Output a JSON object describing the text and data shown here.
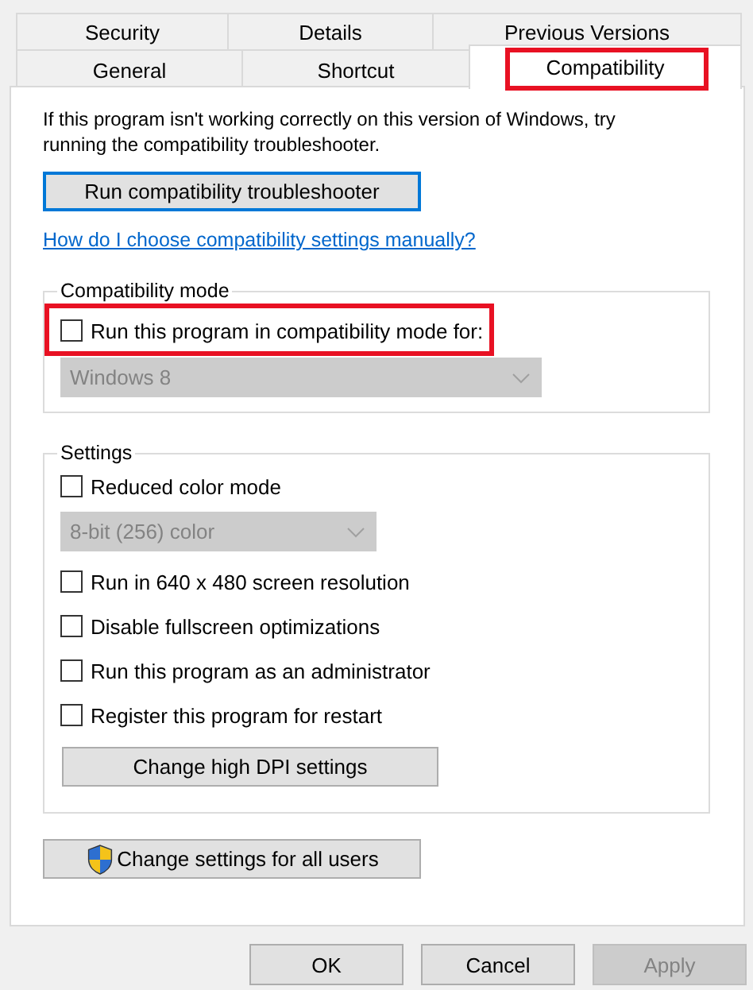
{
  "tab_rows": [
    [
      {
        "label": "Security",
        "selected": false,
        "highlighted": false
      },
      {
        "label": "Details",
        "selected": false,
        "highlighted": false
      },
      {
        "label": "Previous Versions",
        "selected": false,
        "highlighted": false
      }
    ],
    [
      {
        "label": "General",
        "selected": false,
        "highlighted": false
      },
      {
        "label": "Shortcut",
        "selected": false,
        "highlighted": false
      },
      {
        "label": "Compatibility",
        "selected": true,
        "highlighted": true
      }
    ]
  ],
  "intro": "If this program isn't working correctly on this version of Windows, try running the compatibility troubleshooter.",
  "troubleshooter_button": {
    "label": "Run compatibility troubleshooter",
    "focused": true
  },
  "help_link": "How do I choose compatibility settings manually?",
  "compatibility_mode": {
    "legend": "Compatibility mode",
    "checkbox": {
      "label": "Run this program in compatibility mode for:",
      "checked": false,
      "highlighted": true
    },
    "dropdown": {
      "value": "Windows 8",
      "disabled": true
    }
  },
  "settings": {
    "legend": "Settings",
    "items": [
      {
        "kind": "checkbox",
        "label": "Reduced color mode",
        "checked": false
      },
      {
        "kind": "dropdown",
        "value": "8-bit (256) color",
        "disabled": true
      },
      {
        "kind": "checkbox",
        "label": "Run in 640 x 480 screen resolution",
        "checked": false
      },
      {
        "kind": "checkbox",
        "label": "Disable fullscreen optimizations",
        "checked": false
      },
      {
        "kind": "checkbox",
        "label": "Run this program as an administrator",
        "checked": false
      },
      {
        "kind": "checkbox",
        "label": "Register this program for restart",
        "checked": false
      },
      {
        "kind": "button",
        "label": "Change high DPI settings"
      }
    ]
  },
  "all_users_button": {
    "label": "Change settings for all users"
  },
  "buttons": [
    {
      "label": "OK",
      "disabled": false
    },
    {
      "label": "Cancel",
      "disabled": false
    },
    {
      "label": "Apply",
      "disabled": true
    }
  ]
}
